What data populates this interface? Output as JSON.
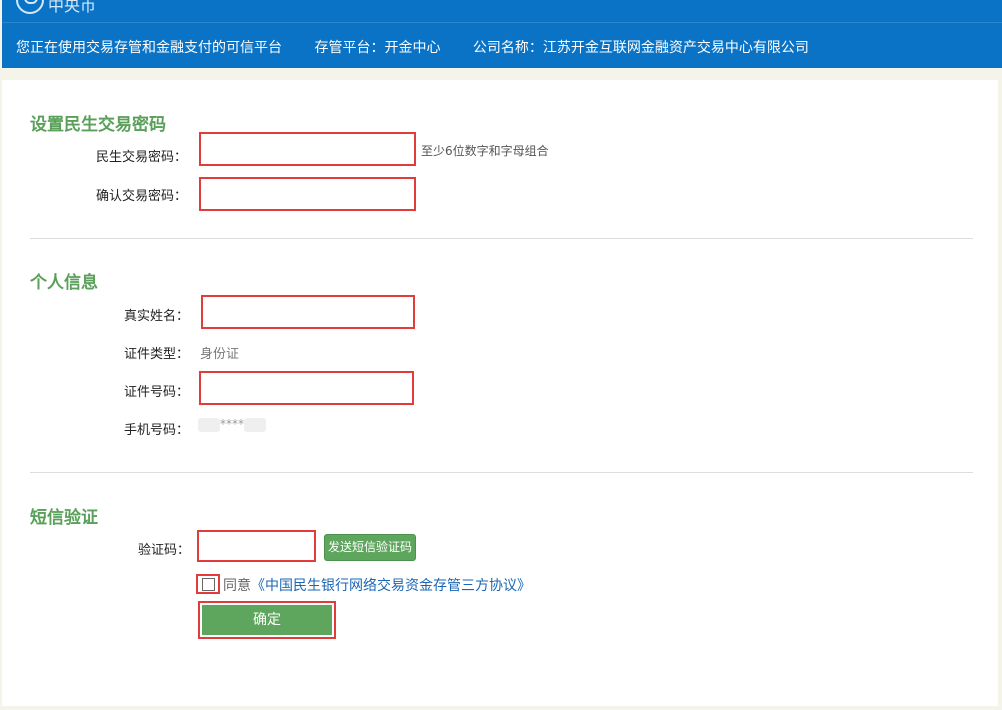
{
  "header": {
    "logo_text": "中央币",
    "notice": "您正在使用交易存管和金融支付的可信平台",
    "platform": "存管平台：开金中心",
    "company": "公司名称：江苏开金互联网金融资产交易中心有限公司"
  },
  "sections": {
    "password": {
      "title": "设置民生交易密码",
      "trade_password_label": "民生交易密码：",
      "trade_password_value": "",
      "trade_password_hint": "至少6位数字和字母组合",
      "confirm_password_label": "确认交易密码：",
      "confirm_password_value": ""
    },
    "personal": {
      "title": "个人信息",
      "name_label": "真实姓名：",
      "name_value": "",
      "id_type_label": "证件类型：",
      "id_type_value": "身份证",
      "id_number_label": "证件号码：",
      "id_number_value": "",
      "phone_label": "手机号码：",
      "phone_value": "****"
    },
    "sms": {
      "title": "短信验证",
      "code_label": "验证码：",
      "code_value": "",
      "send_button": "发送短信验证码",
      "agree_prefix": "同意",
      "agreement_link": "《中国民生银行网络交易资金存管三方协议》",
      "agreement_checked": false,
      "submit_button": "确定"
    }
  },
  "colors": {
    "header_bg": "#0a73c6",
    "section_title": "#5aa05a",
    "button_bg": "#5ea65e",
    "highlight_border": "#e03c3c",
    "link": "#1a66b3"
  }
}
